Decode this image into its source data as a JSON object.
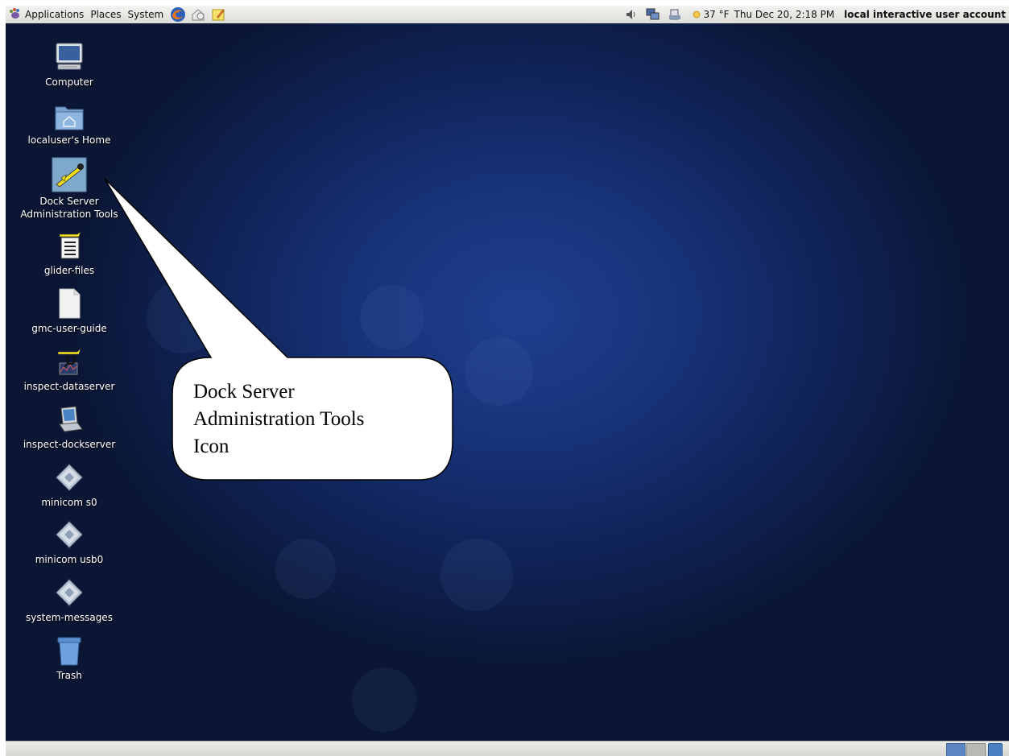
{
  "panel": {
    "menus": [
      "Applications",
      "Places",
      "System"
    ],
    "launchers": [
      "firefox-icon",
      "mail-icon",
      "notes-icon"
    ],
    "weather": "37 °F",
    "clock": "Thu Dec 20,  2:18 PM",
    "user": "local interactive user account"
  },
  "desktop_icons": [
    {
      "label": "Computer",
      "icon": "computer-icon"
    },
    {
      "label": "localuser's Home",
      "icon": "home-folder-icon"
    },
    {
      "label": "Dock Server Administration Tools",
      "icon": "glider-app-icon"
    },
    {
      "label": "glider-files",
      "icon": "glider-files-icon"
    },
    {
      "label": "gmc-user-guide",
      "icon": "document-icon"
    },
    {
      "label": "inspect-dataserver",
      "icon": "inspect-dataserver-icon"
    },
    {
      "label": "inspect-dockserver",
      "icon": "laptop-icon"
    },
    {
      "label": "minicom s0",
      "icon": "script-icon"
    },
    {
      "label": "minicom usb0",
      "icon": "script-icon"
    },
    {
      "label": "system-messages",
      "icon": "script-icon"
    },
    {
      "label": "Trash",
      "icon": "trash-icon"
    }
  ],
  "callout": {
    "lines": [
      "Dock Server",
      "Administration Tools",
      "Icon"
    ]
  },
  "colors": {
    "desktop": "#1a3478",
    "callout_fill": "#ffffff"
  }
}
